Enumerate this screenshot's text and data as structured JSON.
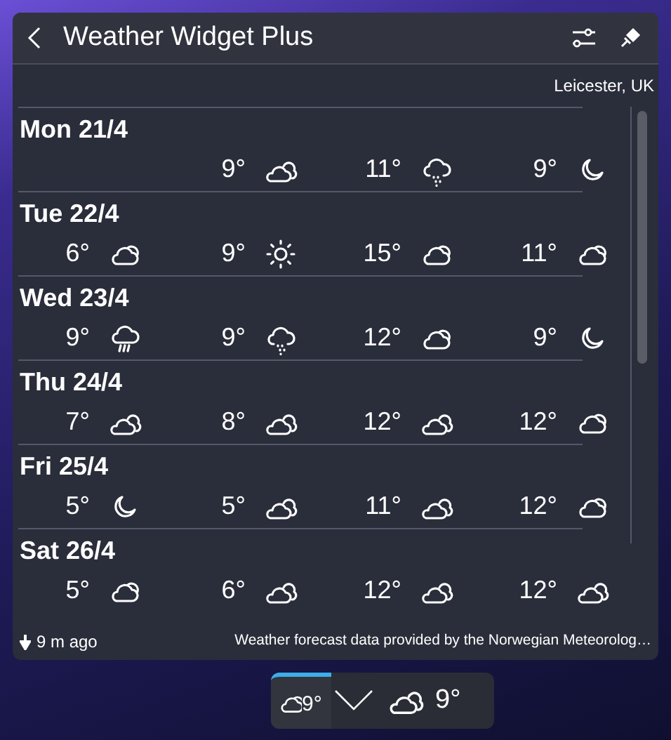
{
  "header": {
    "title": "Weather Widget Plus"
  },
  "location": "Leicester, UK",
  "days": [
    {
      "date": "Mon 21/4",
      "forecasts": [
        {
          "temp": "9°",
          "kind": "partly-cloudy"
        },
        {
          "temp": "11°",
          "kind": "showers"
        },
        {
          "temp": "9°",
          "kind": "clear-night"
        }
      ]
    },
    {
      "date": "Tue 22/4",
      "forecasts": [
        {
          "temp": "6°",
          "kind": "cloudy"
        },
        {
          "temp": "9°",
          "kind": "clear"
        },
        {
          "temp": "15°",
          "kind": "cloudy"
        },
        {
          "temp": "11°",
          "kind": "cloudy"
        }
      ]
    },
    {
      "date": "Wed 23/4",
      "forecasts": [
        {
          "temp": "9°",
          "kind": "rain"
        },
        {
          "temp": "9°",
          "kind": "showers"
        },
        {
          "temp": "12°",
          "kind": "cloudy"
        },
        {
          "temp": "9°",
          "kind": "clear-night"
        }
      ]
    },
    {
      "date": "Thu 24/4",
      "forecasts": [
        {
          "temp": "7°",
          "kind": "partly-cloudy"
        },
        {
          "temp": "8°",
          "kind": "partly-cloudy"
        },
        {
          "temp": "12°",
          "kind": "partly-cloudy"
        },
        {
          "temp": "12°",
          "kind": "cloudy"
        }
      ]
    },
    {
      "date": "Fri 25/4",
      "forecasts": [
        {
          "temp": "5°",
          "kind": "clear-night"
        },
        {
          "temp": "5°",
          "kind": "partly-cloudy"
        },
        {
          "temp": "11°",
          "kind": "partly-cloudy"
        },
        {
          "temp": "12°",
          "kind": "cloudy"
        }
      ]
    },
    {
      "date": "Sat 26/4",
      "forecasts": [
        {
          "temp": "5°",
          "kind": "cloudy"
        },
        {
          "temp": "6°",
          "kind": "partly-cloudy"
        },
        {
          "temp": "12°",
          "kind": "partly-cloudy"
        },
        {
          "temp": "12°",
          "kind": "partly-cloudy"
        }
      ]
    }
  ],
  "footer": {
    "updated": "9 m ago",
    "attribution": "Weather forecast data provided by the Norwegian Meteorolog…"
  },
  "tray": {
    "compact_temperature": "9°",
    "active": true,
    "temperature": "9°"
  }
}
